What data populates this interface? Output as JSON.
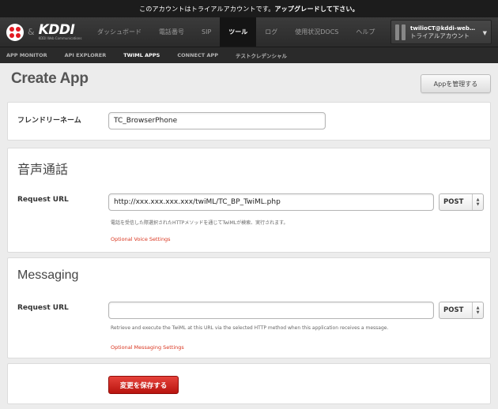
{
  "notice": {
    "text": "このアカウントはトライアルアカウントです。",
    "highlight": "アップグレードして下さい。"
  },
  "header": {
    "brand_amp": "&",
    "brand_name": "KDDI",
    "brand_sub": "KDDI Web Communications",
    "nav": [
      {
        "label": "ダッシュボード",
        "active": false
      },
      {
        "label": "電話番号",
        "active": false
      },
      {
        "label": "SIP",
        "active": false
      },
      {
        "label": "ツール",
        "active": true
      },
      {
        "label": "ログ",
        "active": false
      },
      {
        "label": "使用状況DOCS",
        "active": false
      },
      {
        "label": "ヘルプ",
        "active": false
      }
    ],
    "account": {
      "name": "twilioCT@kddi-web…",
      "type": "トライアルアカウント"
    }
  },
  "subnav": [
    {
      "label": "APP MONITOR",
      "active": false
    },
    {
      "label": "API EXPLORER",
      "active": false
    },
    {
      "label": "TWIML APPS",
      "active": true
    },
    {
      "label": "CONNECT APP",
      "active": false
    },
    {
      "label": "テストクレデンシャル",
      "active": false
    }
  ],
  "page": {
    "title": "Create App",
    "manage_button": "Appを管理する"
  },
  "friendly": {
    "label": "フレンドリーネーム",
    "value": "TC_BrowserPhone"
  },
  "voice": {
    "title": "音声通話",
    "request_label": "Request URL",
    "request_value": "http://xxx.xxx.xxx.xxx/twiML/TC_BP_TwiML.php",
    "method": "POST",
    "hint": "電話を受信した際選択されたHTTPメソッドを通じてTwiMLが検索、実行されます。",
    "optional_link": "Optional Voice Settings"
  },
  "messaging": {
    "title": "Messaging",
    "request_label": "Request URL",
    "request_value": "",
    "method": "POST",
    "hint": "Retrieve and execute the TwiML at this URL via the selected HTTP method when this application receives a message.",
    "optional_link": "Optional Messaging Settings"
  },
  "save_button": "変更を保存する",
  "colors": {
    "accent_red": "#d9341e",
    "header_bg": "#2b2b2b"
  }
}
